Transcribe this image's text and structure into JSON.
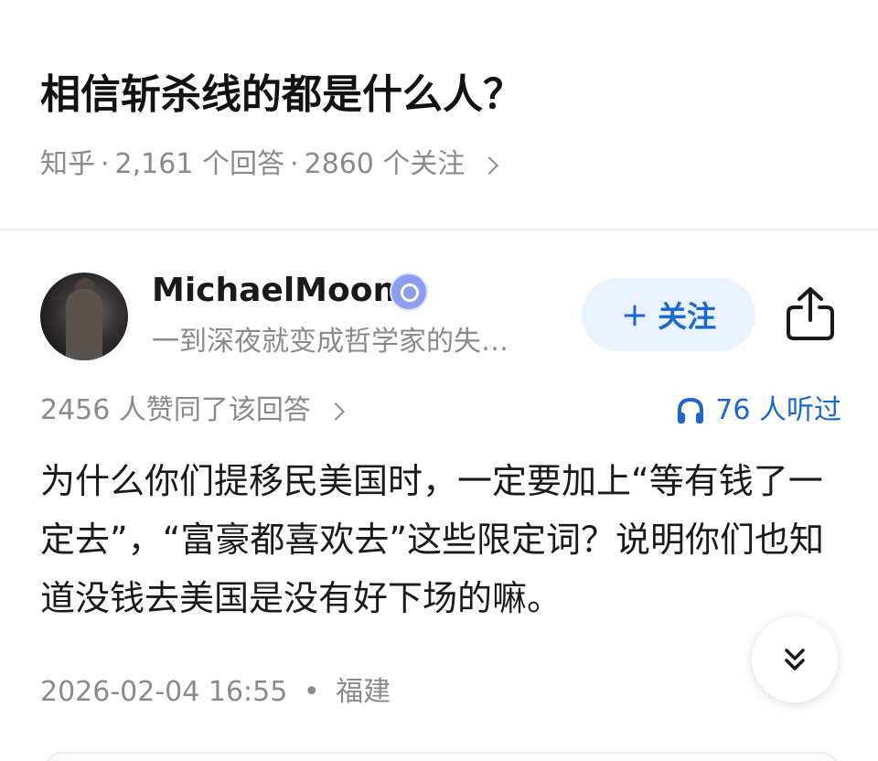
{
  "question": {
    "title": "相信斩杀线的都是什么人？",
    "source": "知乎",
    "answers_count": "2,161 个回答",
    "followers_count": "2860 个关注",
    "separator": "·"
  },
  "author": {
    "name": "MichaelMoon",
    "bio": "一到深夜就变成哲学家的失…",
    "follow_label": "关注",
    "follow_plus": "+"
  },
  "stats": {
    "likes": "2456 人赞同了该回答",
    "listens": "76 人听过"
  },
  "answer": {
    "text": "为什么你们提移民美国时，一定要加上“等有钱了一定去”，“富豪都喜欢去”这些限定词？说明你们也知道没钱去美国是没有好下场的嘛。",
    "timestamp": "2026-02-04 16:55",
    "location_separator": "•",
    "location": "福建"
  },
  "icons": {
    "verified": "verified-badge-icon",
    "share": "share-icon",
    "headphones": "headphones-icon",
    "expand": "double-chevron-down-icon",
    "chevron": "chevron-right-icon"
  },
  "colors": {
    "accent": "#1a66d2",
    "follow_bg": "#eaf2fd",
    "muted_text": "#8a8a8a",
    "verified": "#8c9ef0"
  }
}
